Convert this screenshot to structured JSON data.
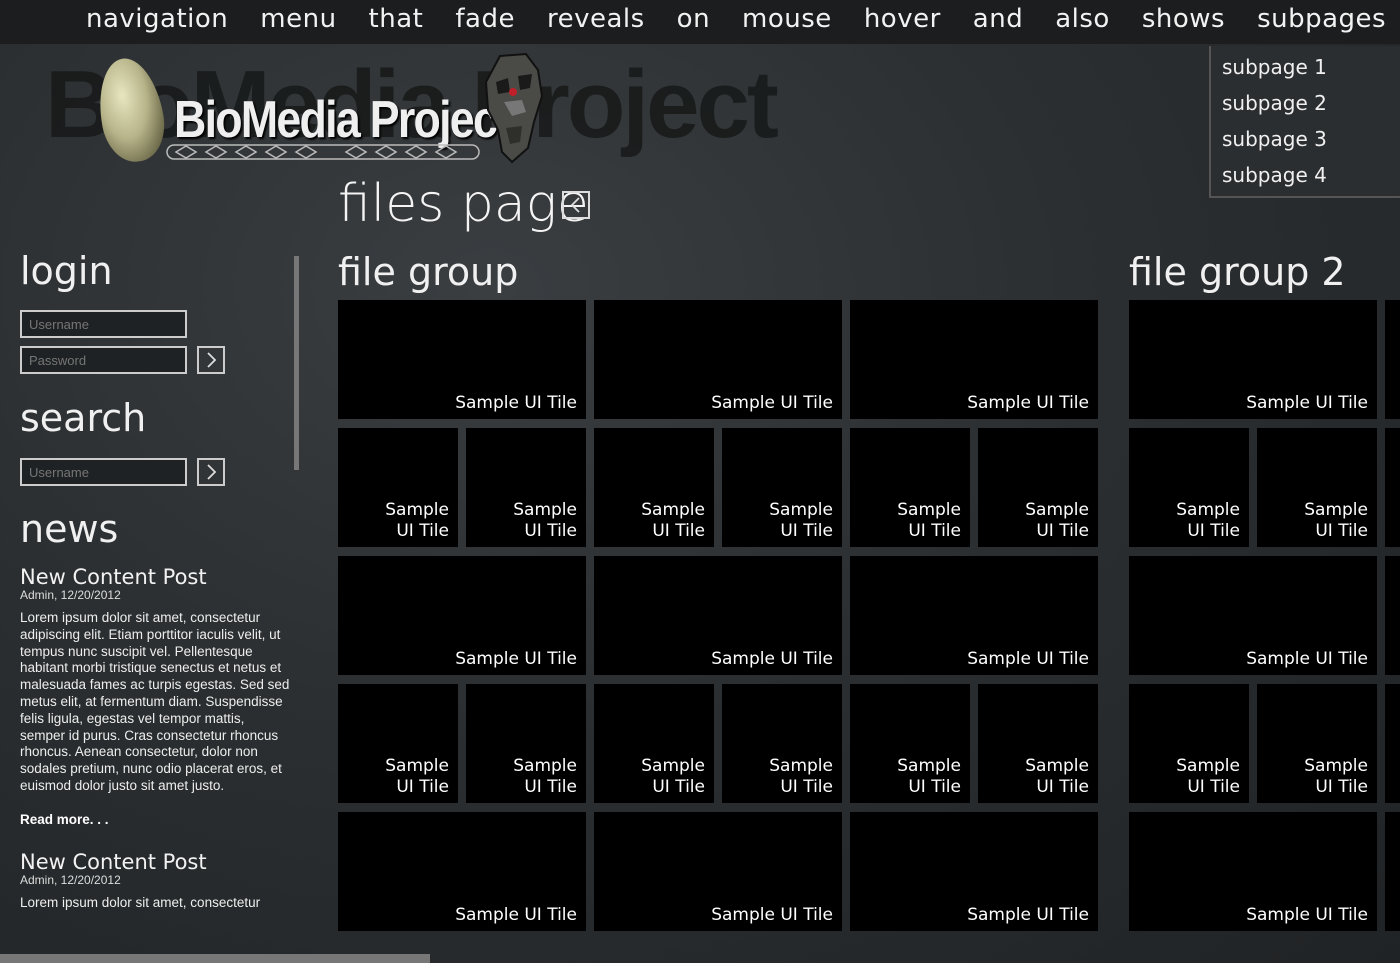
{
  "nav": {
    "items": [
      "navigation",
      "menu",
      "that",
      "fade",
      "reveals",
      "on",
      "mouse",
      "hover",
      "and",
      "also",
      "shows",
      "subpages"
    ],
    "submenu": [
      "subpage 1",
      "subpage 2",
      "subpage 3",
      "subpage 4"
    ]
  },
  "logo": {
    "text": "BioMedia Project",
    "ghost": "BioMedia Project"
  },
  "page": {
    "title": "files page",
    "back_icon": "chevron-left-icon"
  },
  "login": {
    "heading": "login",
    "username_placeholder": "Username",
    "password_placeholder": "Password"
  },
  "search": {
    "heading": "search",
    "placeholder": "Username"
  },
  "news": {
    "heading": "news",
    "posts": [
      {
        "title": "New Content Post",
        "meta": "Admin, 12/20/2012",
        "body": "Lorem ipsum dolor sit amet, consectetur adipiscing elit. Etiam porttitor iaculis velit, ut tempus nunc suscipit vel. Pellentesque habitant morbi tristique senectus et netus et malesuada fames ac turpis egestas. Sed sed metus elit, at fermentum diam. Suspendisse felis ligula, egestas vel tempor mattis, semper id purus. Cras consectetur rhoncus rhoncus. Aenean consectetur, dolor non sodales pretium, nunc odio placerat eros, et euismod dolor justo sit amet justo.",
        "read_more": "Read more. . ."
      },
      {
        "title": "New Content Post",
        "meta": "Admin, 12/20/2012",
        "body": "Lorem ipsum dolor sit amet, consectetur"
      }
    ]
  },
  "groups": [
    {
      "title": "file group"
    },
    {
      "title": "file group 2"
    }
  ],
  "tile": {
    "wide_label": "Sample UI Tile",
    "small_line1": "Sample",
    "small_line2": "UI Tile"
  },
  "colors": {
    "background": "#2b2f31",
    "nav_bar": "#1b1d1e",
    "tile": "#000000"
  }
}
